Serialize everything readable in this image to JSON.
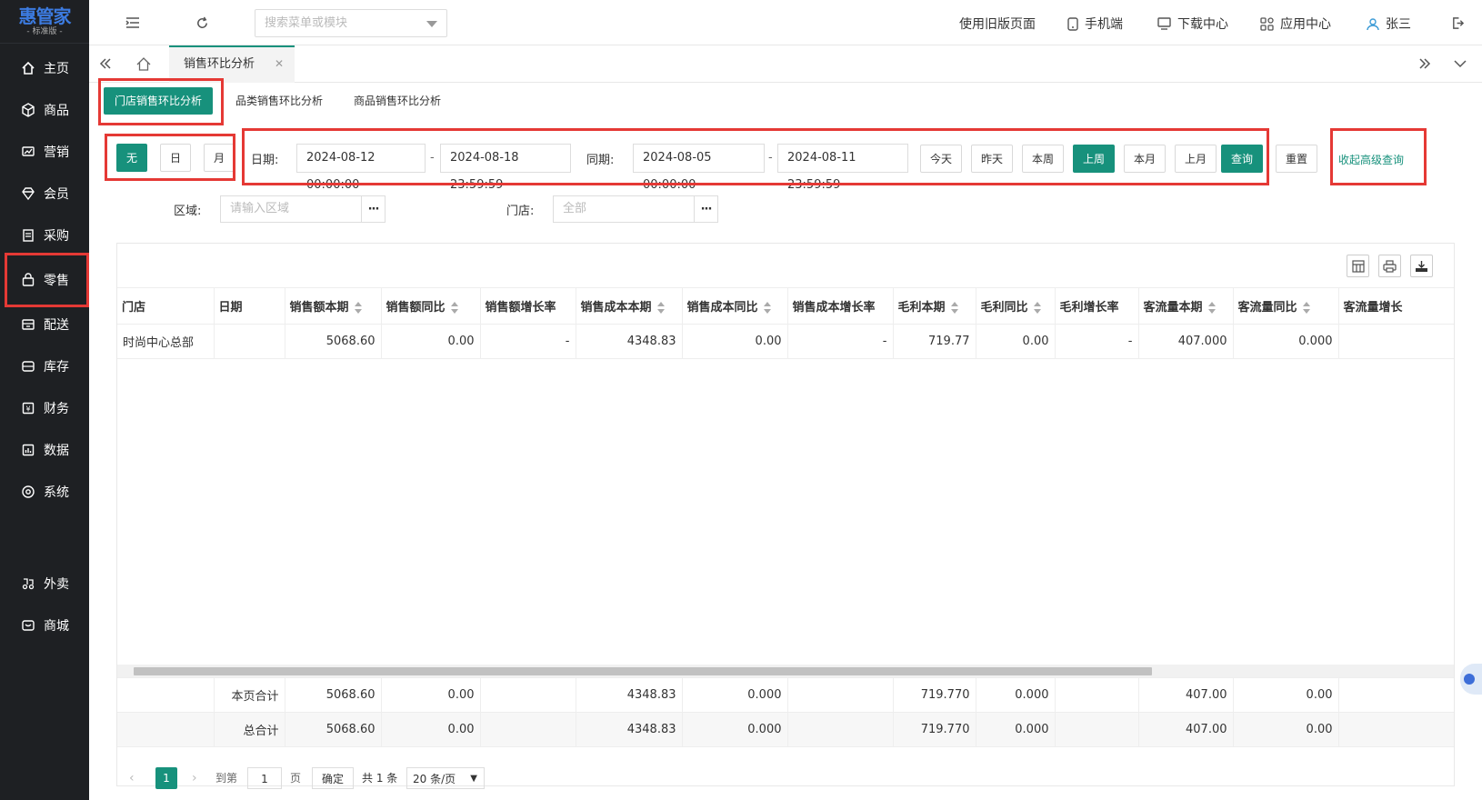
{
  "logo": {
    "title": "惠管家",
    "subtitle": "- 标准版 -"
  },
  "sidebar": {
    "items": [
      {
        "label": "主页",
        "icon": "home-icon"
      },
      {
        "label": "商品",
        "icon": "box-icon"
      },
      {
        "label": "营销",
        "icon": "marketing-icon"
      },
      {
        "label": "会员",
        "icon": "member-icon"
      },
      {
        "label": "采购",
        "icon": "purchase-icon"
      },
      {
        "label": "零售",
        "icon": "retail-bag-icon"
      },
      {
        "label": "配送",
        "icon": "delivery-icon"
      },
      {
        "label": "库存",
        "icon": "inventory-icon"
      },
      {
        "label": "财务",
        "icon": "finance-icon"
      },
      {
        "label": "数据",
        "icon": "data-icon"
      },
      {
        "label": "系统",
        "icon": "system-icon"
      },
      {
        "label": "外卖",
        "icon": "takeout-icon"
      },
      {
        "label": "商城",
        "icon": "mall-icon"
      }
    ]
  },
  "topbar": {
    "search_placeholder": "搜索菜单或模块",
    "links": [
      "使用旧版页面",
      "手机端",
      "下载中心",
      "应用中心",
      "张三"
    ]
  },
  "tabs": {
    "current": "销售环比分析"
  },
  "subtabs": [
    "门店销售环比分析",
    "品类销售环比分析",
    "商品销售环比分析"
  ],
  "filter": {
    "mode_buttons": [
      "无",
      "日",
      "月"
    ],
    "date_label": "日期:",
    "date_start": "2024-08-12 00:00:00",
    "date_end": "2024-08-18 23:59:59",
    "compare_label": "同期:",
    "compare_start": "2024-08-05 00:00:00",
    "compare_end": "2024-08-11 23:59:59",
    "quick": [
      "今天",
      "昨天",
      "本周",
      "上周",
      "本月",
      "上月"
    ],
    "query": "查询",
    "reset": "重置",
    "collapse": "收起高级查询",
    "region_label": "区域:",
    "region_placeholder": "请输入区域",
    "store_label": "门店:",
    "store_placeholder": "全部",
    "dash": "-",
    "ellipsis": "···"
  },
  "table": {
    "columns": [
      "门店",
      "日期",
      "销售额本期",
      "销售额同比",
      "销售额增长率",
      "销售成本本期",
      "销售成本同比",
      "销售成本增长率",
      "毛利本期",
      "毛利同比",
      "毛利增长率",
      "客流量本期",
      "客流量同比",
      "客流量增长"
    ],
    "rows": [
      [
        "时尚中心总部",
        "",
        "5068.60",
        "0.00",
        "-",
        "4348.83",
        "0.00",
        "-",
        "719.77",
        "0.00",
        "-",
        "407.000",
        "0.000",
        ""
      ]
    ],
    "page_total": [
      "",
      "本页合计",
      "5068.60",
      "0.00",
      "",
      "4348.83",
      "0.000",
      "",
      "719.770",
      "0.000",
      "",
      "407.00",
      "0.00",
      ""
    ],
    "grand_total": [
      "",
      "总合计",
      "5068.60",
      "0.00",
      "",
      "4348.83",
      "0.000",
      "",
      "719.770",
      "0.000",
      "",
      "407.00",
      "0.00",
      ""
    ]
  },
  "pager": {
    "current": "1",
    "goto_label": "到第",
    "goto_value": "1",
    "page_unit": "页",
    "confirm": "确定",
    "total": "共 1 条",
    "page_size": "20 条/页"
  },
  "colors": {
    "accent": "#17917c",
    "sidebar_bg": "#1e2023",
    "highlight_frame": "#e53935"
  }
}
